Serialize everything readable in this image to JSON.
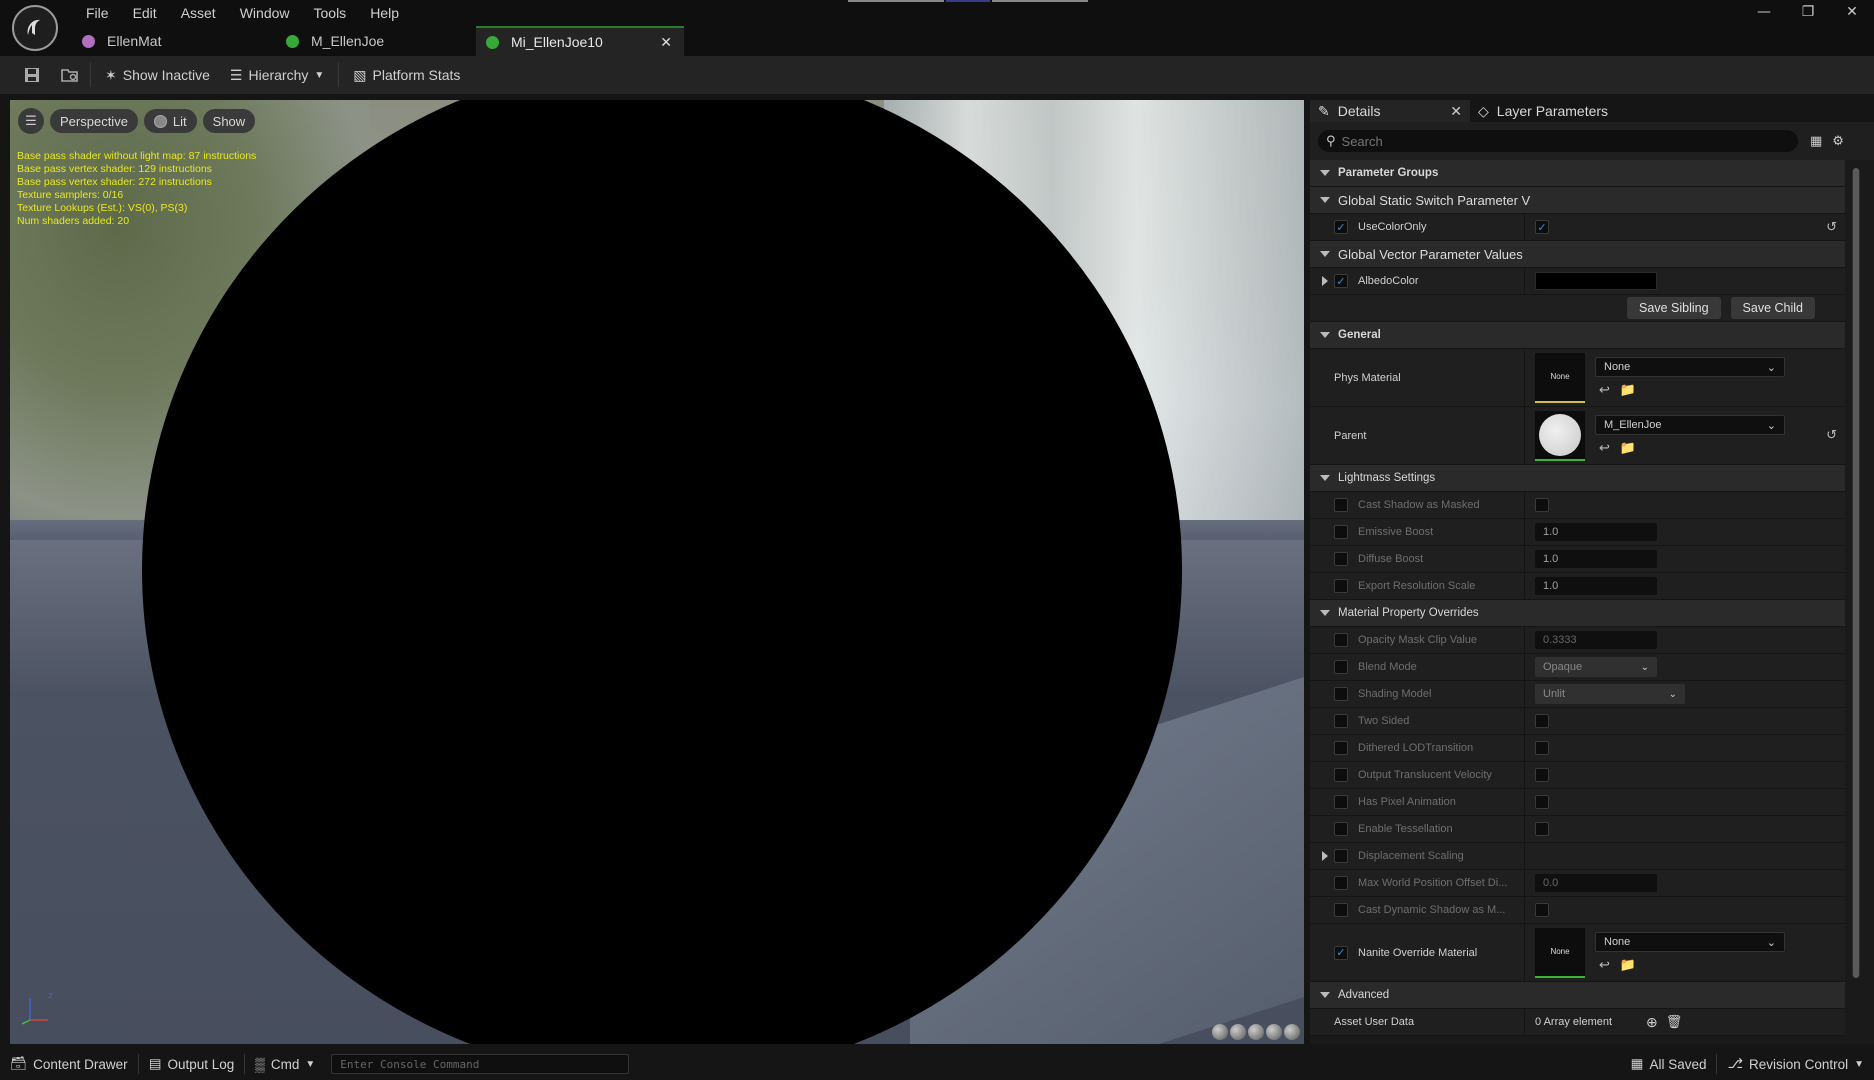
{
  "menu": [
    "File",
    "Edit",
    "Asset",
    "Window",
    "Tools",
    "Help"
  ],
  "tabs": [
    {
      "label": "EllenMat",
      "icon": "material-instance-icon",
      "color": "#b070c0"
    },
    {
      "label": "M_EllenJoe",
      "icon": "material-icon",
      "color": "#38a838"
    },
    {
      "label": "Mi_EllenJoe10",
      "icon": "material-instance-icon",
      "color": "#38a838",
      "active": true
    }
  ],
  "toolbar": {
    "show_inactive": "Show Inactive",
    "hierarchy": "Hierarchy",
    "platform_stats": "Platform Stats"
  },
  "viewport": {
    "perspective": "Perspective",
    "lit": "Lit",
    "show": "Show",
    "stats": [
      "Base pass shader without light map: 87 instructions",
      "Base pass vertex shader: 129 instructions",
      "Base pass vertex shader: 272 instructions",
      "Texture samplers: 0/16",
      "Texture Lookups (Est.): VS(0), PS(3)",
      "Num shaders added: 20"
    ]
  },
  "details": {
    "tab_details": "Details",
    "tab_layer": "Layer Parameters",
    "search_placeholder": "Search",
    "parameter_groups": "Parameter Groups",
    "global_static_switch": "Global Static Switch Parameter V",
    "use_color_only": "UseColorOnly",
    "global_vector": "Global Vector Parameter Values",
    "albedo_color": "AlbedoColor",
    "save_sibling": "Save Sibling",
    "save_child": "Save Child",
    "general": "General",
    "phys_material": "Phys Material",
    "phys_value": "None",
    "thumb_none": "None",
    "parent": "Parent",
    "parent_value": "M_EllenJoe",
    "lightmass": "Lightmass Settings",
    "lightmass_rows": [
      {
        "label": "Cast Shadow as Masked",
        "kind": "check"
      },
      {
        "label": "Emissive Boost",
        "value": "1.0"
      },
      {
        "label": "Diffuse Boost",
        "value": "1.0"
      },
      {
        "label": "Export Resolution Scale",
        "value": "1.0"
      }
    ],
    "mpo": "Material Property Overrides",
    "opacity_mask": {
      "label": "Opacity Mask Clip Value",
      "value": "0.3333"
    },
    "blend_mode": {
      "label": "Blend Mode",
      "value": "Opaque"
    },
    "shading_model": {
      "label": "Shading Model",
      "value": "Unlit"
    },
    "mpo_checks": [
      "Two Sided",
      "Dithered LODTransition",
      "Output Translucent Velocity",
      "Has Pixel Animation",
      "Enable Tessellation"
    ],
    "displacement": "Displacement Scaling",
    "max_wpo": {
      "label": "Max World Position Offset Di...",
      "value": "0.0"
    },
    "cast_dynamic": "Cast Dynamic Shadow as M...",
    "nanite": "Nanite Override Material",
    "nanite_value": "None",
    "advanced": "Advanced",
    "asset_user_data": "Asset User Data",
    "array_elements": "0 Array element"
  },
  "bottom": {
    "content_drawer": "Content Drawer",
    "output_log": "Output Log",
    "cmd": "Cmd",
    "console_placeholder": "Enter Console Command",
    "all_saved": "All Saved",
    "revision_control": "Revision Control"
  }
}
